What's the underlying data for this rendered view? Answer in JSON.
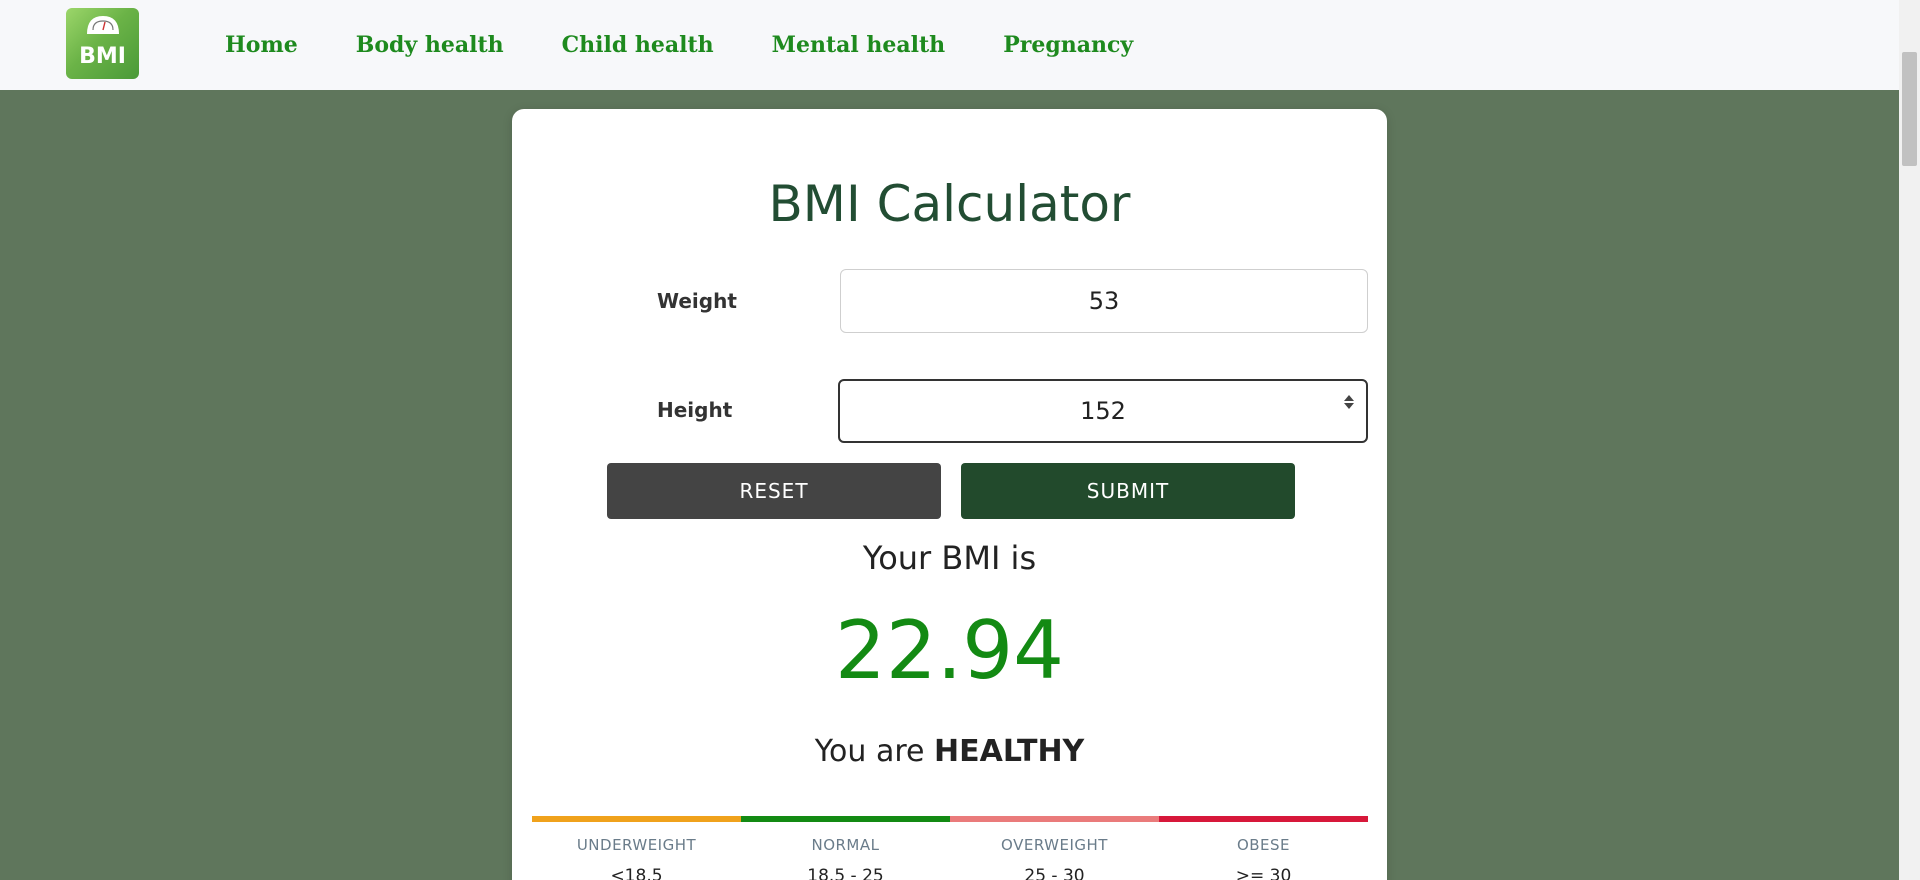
{
  "nav": {
    "logo_text": "BMI",
    "links": [
      {
        "label": "Home"
      },
      {
        "label": "Body health"
      },
      {
        "label": "Child health"
      },
      {
        "label": "Mental health"
      },
      {
        "label": "Pregnancy"
      }
    ]
  },
  "calculator": {
    "title": "BMI Calculator",
    "weight_label": "Weight",
    "weight_value": "53",
    "height_label": "Height",
    "height_value": "152",
    "reset_label": "RESET",
    "submit_label": "SUBMIT",
    "result_label": "Your BMI is",
    "result_value": "22.94",
    "status_prefix": "You are",
    "status_value": "HEALTHY"
  },
  "categories": [
    {
      "label": "UNDERWEIGHT",
      "range": "<18.5",
      "color": "#f0a21c"
    },
    {
      "label": "NORMAL",
      "range": "18.5 - 25",
      "color": "#138a13"
    },
    {
      "label": "OVERWEIGHT",
      "range": "25 - 30",
      "color": "#ea7b7b"
    },
    {
      "label": "OBESE",
      "range": ">= 30",
      "color": "#d7183a"
    }
  ]
}
